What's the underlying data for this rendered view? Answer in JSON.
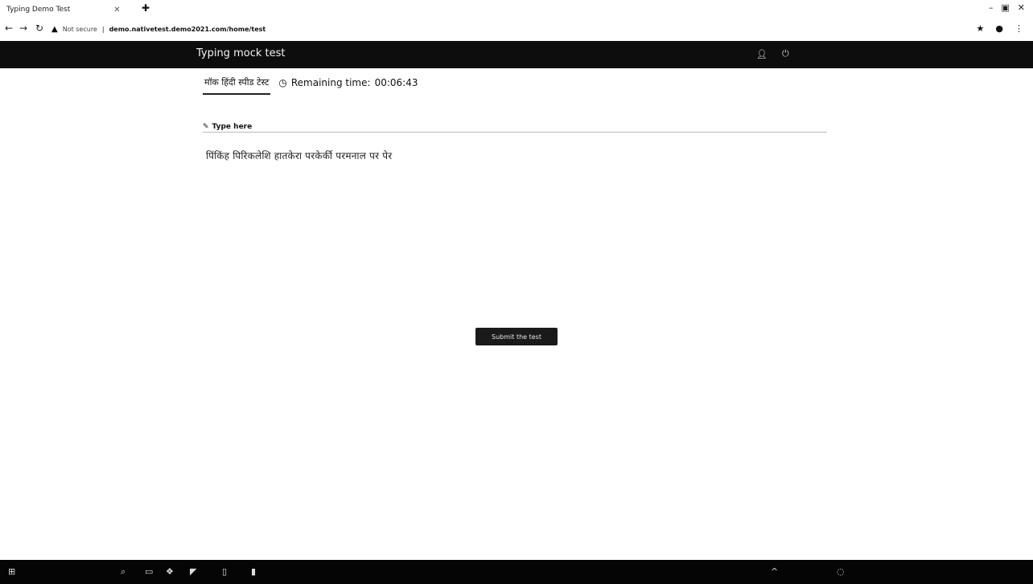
{
  "browser": {
    "tab_title": "Typing Demo Test",
    "address": {
      "not_secure_label": "Not secure",
      "url": "demo.nativetest.demo2021.com/home/test"
    }
  },
  "app": {
    "title": "Typing mock test"
  },
  "test": {
    "tab_label": "मॉक हिंदी स्पीड टेस्ट",
    "remaining_label": "Remaining time:",
    "remaining_value": "00:06:43"
  },
  "editor": {
    "type_here_label": "Type here",
    "typed_text": "पिंकिंह  पिरिकलेशि  हातकेरा  परकेर्की  परमनाल  पर  पेर"
  },
  "actions": {
    "submit_label": "Submit the test"
  },
  "icons": {
    "back": "back-arrow-icon",
    "forward": "forward-arrow-icon",
    "reload": "reload-icon",
    "warning": "warning-icon",
    "star": "star-icon",
    "profile": "profile-icon",
    "menu": "kebab-menu-icon",
    "user": "user-icon",
    "power": "power-icon",
    "clock": "clock-icon",
    "edit": "edit-icon",
    "start": "windows-start-icon"
  },
  "colors": {
    "appbar": "#0d0d0d",
    "taskbar": "#050505",
    "button": "#1a1a1a"
  }
}
